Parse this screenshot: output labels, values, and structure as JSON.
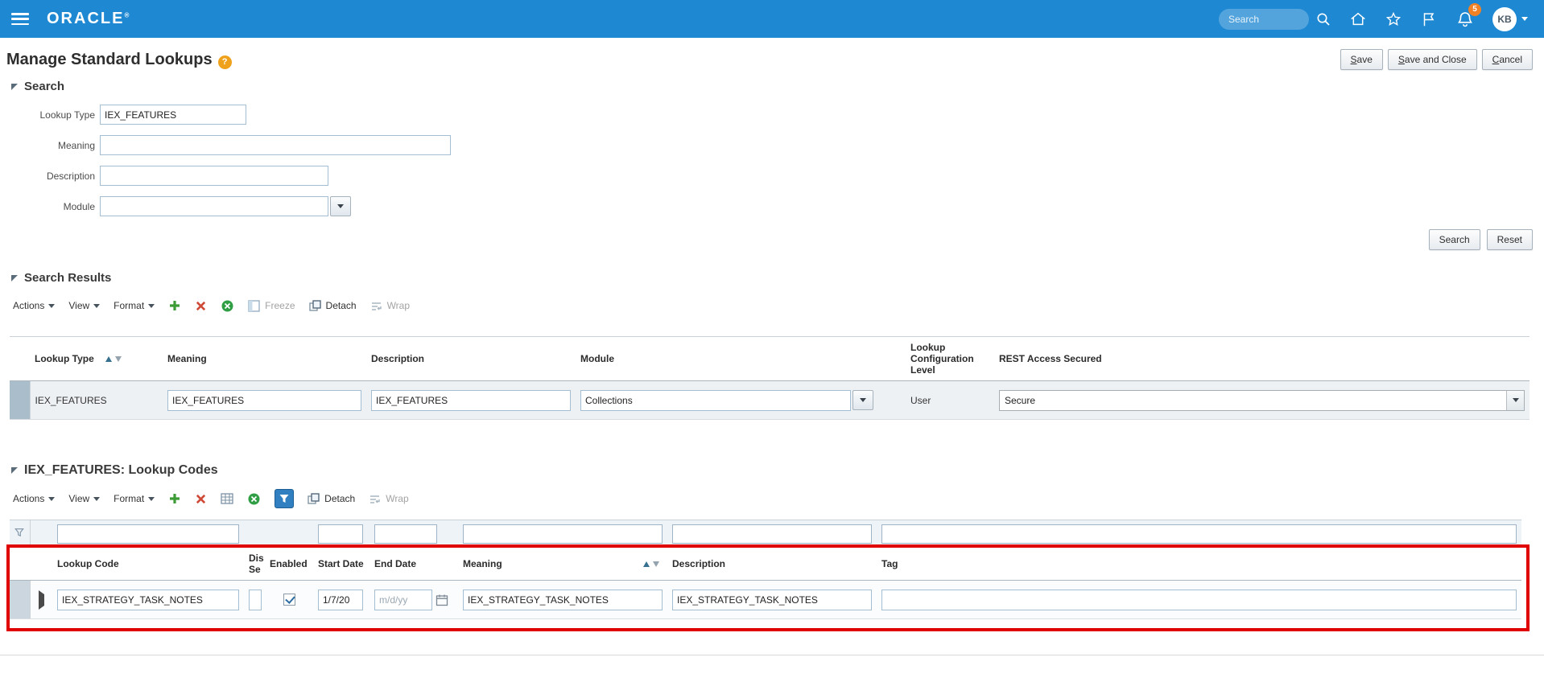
{
  "colors": {
    "header_blue": "#1e88d2",
    "annotation_red": "#e10000",
    "badge_orange": "#f08125",
    "help_orange": "#efa11b"
  },
  "topbar": {
    "brand": "ORACLE",
    "search_placeholder": "Search",
    "notification_count": "5",
    "avatar_initials": "KB"
  },
  "page": {
    "title": "Manage Standard Lookups",
    "save_label": "Save",
    "save_close_label": "Save and Close",
    "cancel_label": "Cancel"
  },
  "search": {
    "section_title": "Search",
    "lookup_type_label": "Lookup Type",
    "lookup_type_value": "IEX_FEATURES",
    "meaning_label": "Meaning",
    "meaning_value": "",
    "description_label": "Description",
    "description_value": "",
    "module_label": "Module",
    "module_value": "",
    "search_button": "Search",
    "reset_button": "Reset"
  },
  "results": {
    "section_title": "Search Results",
    "toolbar": {
      "actions": "Actions",
      "view": "View",
      "format": "Format",
      "freeze": "Freeze",
      "detach": "Detach",
      "wrap": "Wrap"
    },
    "columns": {
      "lookup_type": "Lookup Type",
      "meaning": "Meaning",
      "description": "Description",
      "module": "Module",
      "config_level": "Lookup Configuration Level",
      "rest_access": "REST Access Secured"
    },
    "row": {
      "lookup_type": "IEX_FEATURES",
      "meaning": "IEX_FEATURES",
      "description": "IEX_FEATURES",
      "module": "Collections",
      "config_level": "User",
      "rest_access": "Secure"
    }
  },
  "codes": {
    "section_title": "IEX_FEATURES: Lookup Codes",
    "toolbar": {
      "actions": "Actions",
      "view": "View",
      "format": "Format",
      "detach": "Detach",
      "wrap": "Wrap"
    },
    "columns": {
      "lookup_code": "Lookup Code",
      "display_sequence": "Dis Se",
      "enabled": "Enabled",
      "start_date": "Start Date",
      "end_date": "End Date",
      "meaning": "Meaning",
      "description": "Description",
      "tag": "Tag"
    },
    "row": {
      "lookup_code": "IEX_STRATEGY_TASK_NOTES",
      "display_sequence": "",
      "enabled_state": "checked",
      "start_date": "1/7/20",
      "end_date_value": "",
      "end_date_placeholder": "m/d/yy",
      "meaning": "IEX_STRATEGY_TASK_NOTES",
      "description": "IEX_STRATEGY_TASK_NOTES",
      "tag": ""
    }
  }
}
